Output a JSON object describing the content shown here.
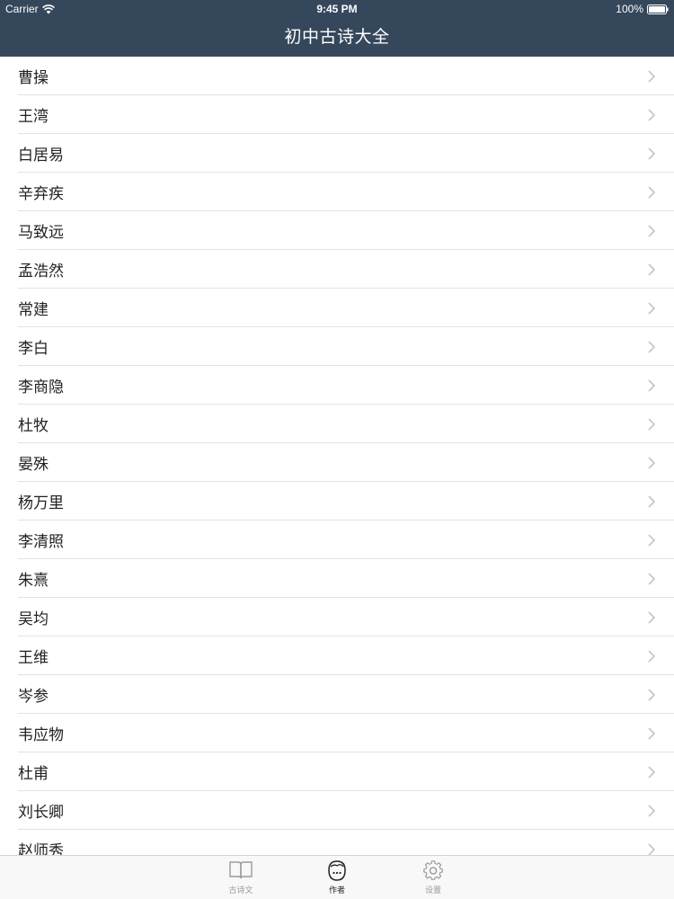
{
  "status_bar": {
    "carrier": "Carrier",
    "time": "9:45 PM",
    "battery": "100%"
  },
  "nav": {
    "title": "初中古诗大全"
  },
  "authors": [
    "曹操",
    "王湾",
    "白居易",
    "辛弃疾",
    "马致远",
    "孟浩然",
    "常建",
    "李白",
    "李商隐",
    "杜牧",
    "晏殊",
    "杨万里",
    "李清照",
    "朱熹",
    "吴均",
    "王维",
    "岑参",
    "韦应物",
    "杜甫",
    "刘长卿",
    "赵师秀"
  ],
  "tabs": [
    {
      "label": "古诗文",
      "icon": "book-icon",
      "active": false
    },
    {
      "label": "作者",
      "icon": "face-icon",
      "active": true
    },
    {
      "label": "设置",
      "icon": "gear-icon",
      "active": false
    }
  ],
  "colors": {
    "header_bg": "#35475b",
    "tab_bar_bg": "#f8f8f8",
    "separator": "#e2e2e2"
  }
}
